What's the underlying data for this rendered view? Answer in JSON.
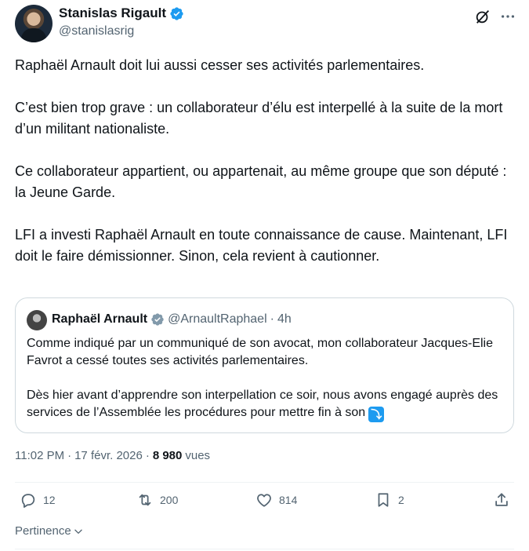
{
  "author": {
    "display_name": "Stanislas Rigault",
    "handle": "@stanislasrig"
  },
  "tweet": {
    "paragraphs": [
      "Raphaël Arnault doit lui aussi cesser ses activités parlementaires.",
      "C’est bien trop grave : un collaborateur d’élu est interpellé à la suite de la mort d’un militant nationaliste.",
      "Ce collaborateur appartient, ou appartenait, au même groupe que son député : la Jeune Garde.",
      "LFI a investi Raphaël Arnault en toute connaissance de cause. Maintenant, LFI doit le faire démissionner. Sinon, cela revient à cautionner."
    ]
  },
  "quote": {
    "display_name": "Raphaël Arnault",
    "handle": "@ArnaultRaphael",
    "separator": "·",
    "time": "4h",
    "paragraphs": [
      "Comme indiqué par un communiqué de son avocat, mon collaborateur Jacques-Elie Favrot a cessé toutes ses activités parlementaires.",
      "Dès hier avant d’apprendre son interpellation ce soir, nous avons engagé auprès des services de l’Assemblée les procédures pour mettre fin à son"
    ],
    "more_glyph": "⤵"
  },
  "meta": {
    "time": "11:02 PM",
    "dot1": "·",
    "date": "17 févr. 2026",
    "dot2": "·",
    "views_count": "8 980",
    "views_label": "vues"
  },
  "actions": {
    "replies": "12",
    "reposts": "200",
    "likes": "814",
    "bookmarks": "2"
  },
  "sort": {
    "label": "Pertinence"
  },
  "colors": {
    "verified": "#1d9bf0",
    "secondary_text": "#536471",
    "border": "#cfd9de"
  },
  "icons": [
    "verified-badge-icon",
    "grok-icon",
    "more-icon",
    "reply-icon",
    "repost-icon",
    "like-icon",
    "bookmark-icon",
    "share-icon",
    "chevron-down-icon"
  ]
}
